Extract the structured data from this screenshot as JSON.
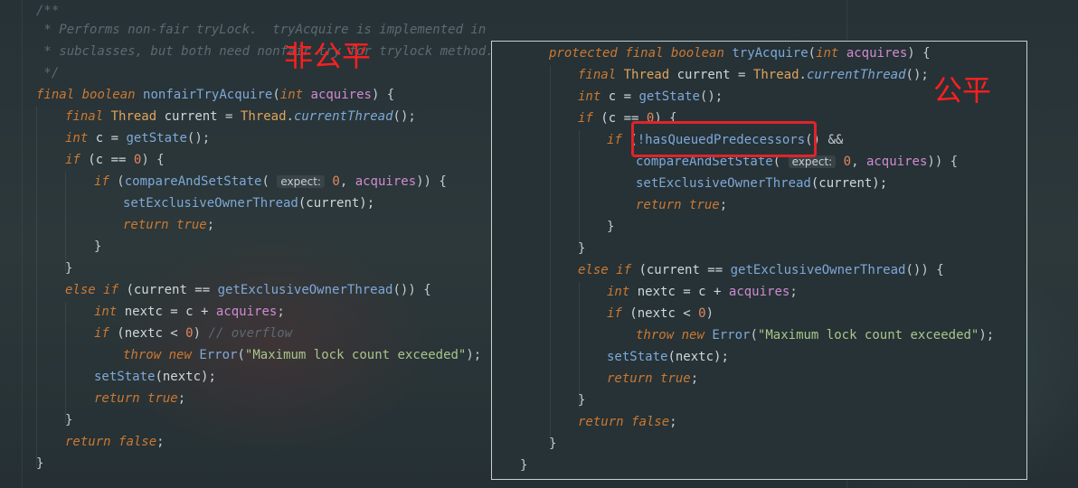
{
  "left_code": {
    "comment": [
      "/**",
      " * Performs non-fair tryLock.  tryAcquire is implemented in",
      " * subclasses, but both need nonfair try for trylock method.",
      " */"
    ],
    "sig": {
      "final": "final",
      "boolean": "boolean",
      "name": "nonfairTryAcquire",
      "int": "int",
      "param": "acquires",
      "end": ") {"
    },
    "l_current": {
      "final": "final",
      "type": "Thread",
      "var": "current",
      "eq": " = ",
      "cls": "Thread",
      "dot": ".",
      "fn": "currentThread",
      "end": "();"
    },
    "l_state": {
      "int": "int",
      "rest": "c = ",
      "fn": "getState",
      "end": "();"
    },
    "l_if0": {
      "if": "if",
      "a": "(c == ",
      "num": "0",
      "b": ") {"
    },
    "l_cas": {
      "if": "if",
      "a": "(",
      "fn": "compareAndSetState",
      "b": "(",
      "hint": "expect:",
      "num": "0",
      "c": ", ",
      "param": "acquires",
      "d": ")) {"
    },
    "l_setowner": {
      "fn": "setExclusiveOwnerThread",
      "end": "(current);"
    },
    "l_ret_true1": {
      "ret": "return",
      "val": "true",
      "end": ";"
    },
    "close1": "}",
    "close2": "}",
    "l_elseif": {
      "else": "else",
      "if": "if",
      "a": "(current == ",
      "fn": "getExclusiveOwnerThread",
      "b": "()) {"
    },
    "l_nextc": {
      "int": "int",
      "a": "nextc = c + ",
      "param": "acquires",
      "b": ";"
    },
    "l_overflow": {
      "if": "if",
      "a": "(nextc < ",
      "num": "0",
      "b": ") ",
      "cmt": "// overflow"
    },
    "l_throw": {
      "throw": "throw",
      "new": "new",
      "cls": "Error",
      "a": "(",
      "str": "\"Maximum lock count exceeded\"",
      "b": ");"
    },
    "l_setstate": {
      "fn": "setState",
      "end": "(nextc);"
    },
    "l_ret_true2": {
      "ret": "return",
      "val": "true",
      "end": ";"
    },
    "close3": "}",
    "l_ret_false": {
      "ret": "return",
      "val": "false",
      "end": ";"
    },
    "close4": "}"
  },
  "right_code": {
    "sig": {
      "protected": "protected",
      "final": "final",
      "boolean": "boolean",
      "name": "tryAcquire",
      "a": "(",
      "int": "int",
      "param": "acquires",
      "end": ") {"
    },
    "l_current": {
      "final": "final",
      "type": "Thread",
      "var": "current",
      "eq": " = ",
      "cls": "Thread",
      "dot": ".",
      "fn": "currentThread",
      "end": "();"
    },
    "l_state": {
      "int": "int",
      "rest": "c = ",
      "fn": "getState",
      "end": "();"
    },
    "l_if0": {
      "if": "if",
      "a": "(c == ",
      "num": "0",
      "b": ") {"
    },
    "l_hq": {
      "if": "if",
      "a": "(",
      "fn": "!hasQueuedPredecessors",
      "b": "() &&"
    },
    "l_cas": {
      "fn": "compareAndSetState",
      "b": "(",
      "hint": "expect:",
      "num": "0",
      "c": ", ",
      "param": "acquires",
      "d": ")) {"
    },
    "l_setowner": {
      "fn": "setExclusiveOwnerThread",
      "end": "(current);"
    },
    "l_ret_true1": {
      "ret": "return",
      "val": "true",
      "end": ";"
    },
    "close1": "}",
    "close2": "}",
    "l_elseif": {
      "else": "else",
      "if": "if",
      "a": "(current == ",
      "fn": "getExclusiveOwnerThread",
      "b": "()) {"
    },
    "l_nextc": {
      "int": "int",
      "a": "nextc = c + ",
      "param": "acquires",
      "b": ";"
    },
    "l_overflow": {
      "if": "if",
      "a": "(nextc < ",
      "num": "0",
      "b": ")"
    },
    "l_throw": {
      "throw": "throw",
      "new": "new",
      "cls": "Error",
      "a": "(",
      "str": "\"Maximum lock count exceeded\"",
      "b": ");"
    },
    "l_setstate": {
      "fn": "setState",
      "end": "(nextc);"
    },
    "l_ret_true2": {
      "ret": "return",
      "val": "true",
      "end": ";"
    },
    "close3": "}",
    "l_ret_false": {
      "ret": "return",
      "val": "false",
      "end": ";"
    },
    "close4": "}",
    "close5": "}"
  },
  "annotations": {
    "nonfair": "非公平",
    "fair": "公平"
  },
  "colors": {
    "annotation": "#ff1f1f",
    "highlight_box": "#e0242a"
  }
}
